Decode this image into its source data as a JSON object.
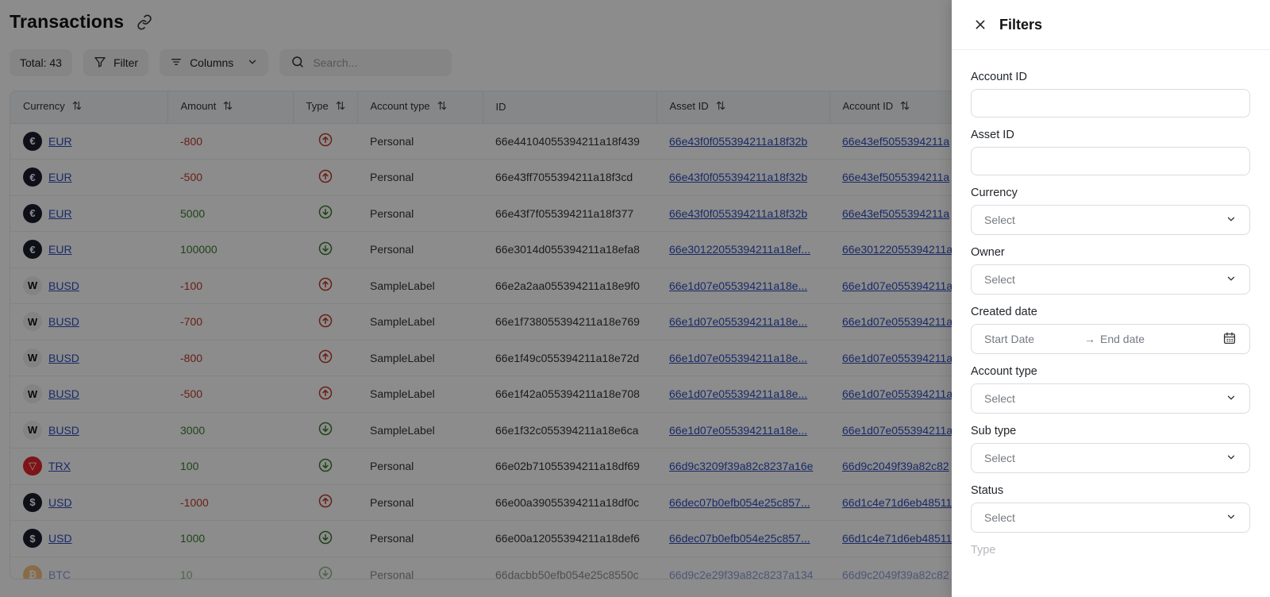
{
  "page": {
    "title": "Transactions",
    "total_label": "Total: 43",
    "filter_label": "Filter",
    "columns_label": "Columns",
    "search_placeholder": "Search..."
  },
  "table": {
    "headers": [
      "Currency",
      "Amount",
      "Type",
      "Account type",
      "ID",
      "Asset ID",
      "Account ID"
    ],
    "rows": [
      {
        "currency": "EUR",
        "icon": "euro-coin-icon",
        "amount": "-800",
        "direction": "out",
        "account_type": "Personal",
        "id": "66e44104055394211a18f439",
        "asset_id": "66e43f0f055394211a18f32b",
        "account_id": "66e43ef5055394211a"
      },
      {
        "currency": "EUR",
        "icon": "euro-coin-icon",
        "amount": "-500",
        "direction": "out",
        "account_type": "Personal",
        "id": "66e43ff7055394211a18f3cd",
        "asset_id": "66e43f0f055394211a18f32b",
        "account_id": "66e43ef5055394211a"
      },
      {
        "currency": "EUR",
        "icon": "euro-coin-icon",
        "amount": "5000",
        "direction": "in",
        "account_type": "Personal",
        "id": "66e43f7f055394211a18f377",
        "asset_id": "66e43f0f055394211a18f32b",
        "account_id": "66e43ef5055394211a"
      },
      {
        "currency": "EUR",
        "icon": "euro-coin-icon",
        "amount": "100000",
        "direction": "in",
        "account_type": "Personal",
        "id": "66e3014d055394211a18efa8",
        "asset_id": "66e30122055394211a18ef...",
        "account_id": "66e30122055394211a"
      },
      {
        "currency": "BUSD",
        "icon": "busd-coin-icon",
        "amount": "-100",
        "direction": "out",
        "account_type": "SampleLabel",
        "id": "66e2a2aa055394211a18e9f0",
        "asset_id": "66e1d07e055394211a18e...",
        "account_id": "66e1d07e055394211a"
      },
      {
        "currency": "BUSD",
        "icon": "busd-coin-icon",
        "amount": "-700",
        "direction": "out",
        "account_type": "SampleLabel",
        "id": "66e1f738055394211a18e769",
        "asset_id": "66e1d07e055394211a18e...",
        "account_id": "66e1d07e055394211a"
      },
      {
        "currency": "BUSD",
        "icon": "busd-coin-icon",
        "amount": "-800",
        "direction": "out",
        "account_type": "SampleLabel",
        "id": "66e1f49c055394211a18e72d",
        "asset_id": "66e1d07e055394211a18e...",
        "account_id": "66e1d07e055394211a"
      },
      {
        "currency": "BUSD",
        "icon": "busd-coin-icon",
        "amount": "-500",
        "direction": "out",
        "account_type": "SampleLabel",
        "id": "66e1f42a055394211a18e708",
        "asset_id": "66e1d07e055394211a18e...",
        "account_id": "66e1d07e055394211a"
      },
      {
        "currency": "BUSD",
        "icon": "busd-coin-icon",
        "amount": "3000",
        "direction": "in",
        "account_type": "SampleLabel",
        "id": "66e1f32c055394211a18e6ca",
        "asset_id": "66e1d07e055394211a18e...",
        "account_id": "66e1d07e055394211a"
      },
      {
        "currency": "TRX",
        "icon": "trx-coin-icon",
        "amount": "100",
        "direction": "in",
        "account_type": "Personal",
        "id": "66e02b71055394211a18df69",
        "asset_id": "66d9c3209f39a82c8237a16e",
        "account_id": "66d9c2049f39a82c82"
      },
      {
        "currency": "USD",
        "icon": "usd-coin-icon",
        "amount": "-1000",
        "direction": "out",
        "account_type": "Personal",
        "id": "66e00a39055394211a18df0c",
        "asset_id": "66dec07b0efb054e25c857...",
        "account_id": "66d1c4e71d6eb48511"
      },
      {
        "currency": "USD",
        "icon": "usd-coin-icon",
        "amount": "1000",
        "direction": "in",
        "account_type": "Personal",
        "id": "66e00a12055394211a18def6",
        "asset_id": "66dec07b0efb054e25c857...",
        "account_id": "66d1c4e71d6eb48511"
      },
      {
        "currency": "BTC",
        "icon": "btc-coin-icon",
        "amount": "10",
        "direction": "in",
        "account_type": "Personal",
        "id": "66dacbb50efb054e25c8550c",
        "asset_id": "66d9c2e29f39a82c8237a134",
        "account_id": "66d9c2049f39a82c82"
      }
    ]
  },
  "filters": {
    "title": "Filters",
    "account_id_label": "Account ID",
    "asset_id_label": "Asset ID",
    "currency_label": "Currency",
    "currency_value": "Select",
    "owner_label": "Owner",
    "owner_value": "Select",
    "created_date_label": "Created date",
    "start_date_placeholder": "Start Date",
    "end_date_placeholder": "End date",
    "account_type_label": "Account type",
    "account_type_value": "Select",
    "sub_type_label": "Sub type",
    "sub_type_value": "Select",
    "status_label": "Status",
    "status_value": "Select",
    "type_label": "Type"
  },
  "colors": {
    "link": "#2f4dbd",
    "negative": "#c0392b",
    "positive": "#3a7d2c"
  }
}
